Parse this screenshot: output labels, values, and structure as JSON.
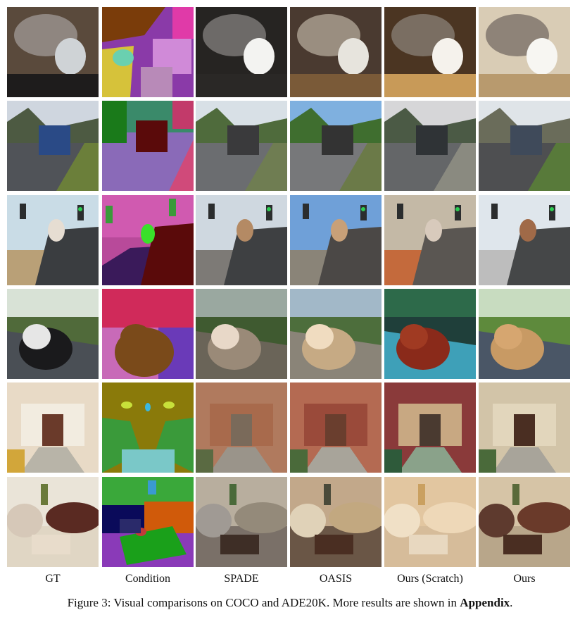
{
  "columns": [
    "GT",
    "Condition",
    "SPADE",
    "OASIS",
    "Ours (Scratch)",
    "Ours"
  ],
  "rows": [
    "cat-drinking-from-cup",
    "truck-on-street",
    "dog-in-car-traffic-lights",
    "teddy-bear-on-bench",
    "building-entrance-stairs",
    "living-room-sofas"
  ],
  "caption": {
    "main": "Figure 3: Visual comparisons on COCO and ADE20K. More results are shown in ",
    "bold": "Appendix",
    "end": "."
  }
}
